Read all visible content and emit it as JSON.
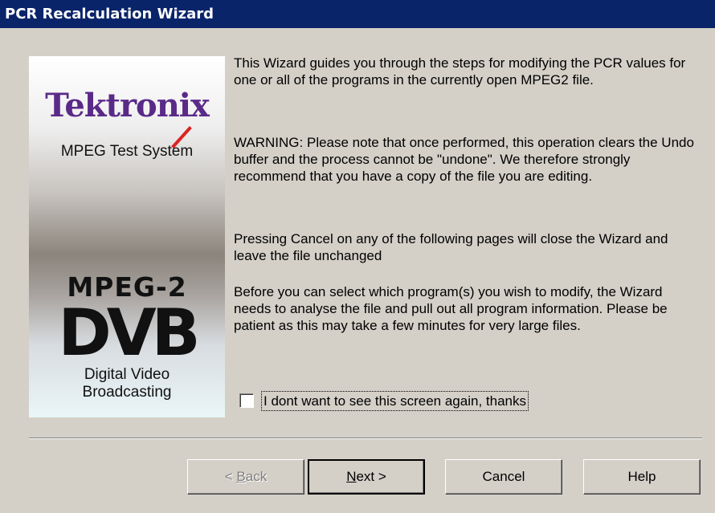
{
  "window": {
    "title": "PCR Recalculation Wizard"
  },
  "banner": {
    "brand": "Tektronix",
    "subtitle": "MPEG Test System",
    "mpeg_label": "MPEG-2",
    "dvb_logo": "DVB",
    "dvb_line1": "Digital Video",
    "dvb_line2": "Broadcasting"
  },
  "content": {
    "paragraphs": [
      "This Wizard guides you through the steps for modifying the PCR values for one or all of the programs in the currently open MPEG2 file.",
      "WARNING: Please note that once performed, this operation clears the Undo buffer and the process cannot be \"undone\". We therefore strongly recommend that you have a copy of the file you are editing.",
      "Pressing Cancel on any of the following pages will close the Wizard and leave the file unchanged",
      "Before you can select which program(s) you wish to modify, the Wizard needs to analyse the file and pull out all program information. Please be patient as this may take a few minutes for very large files."
    ],
    "checkbox_label": "I dont want to see this screen again, thanks",
    "checkbox_checked": false
  },
  "buttons": {
    "back_pre": "< ",
    "back_key": "B",
    "back_post": "ack",
    "next_key": "N",
    "next_post": "ext >",
    "cancel": "Cancel",
    "help": "Help"
  }
}
